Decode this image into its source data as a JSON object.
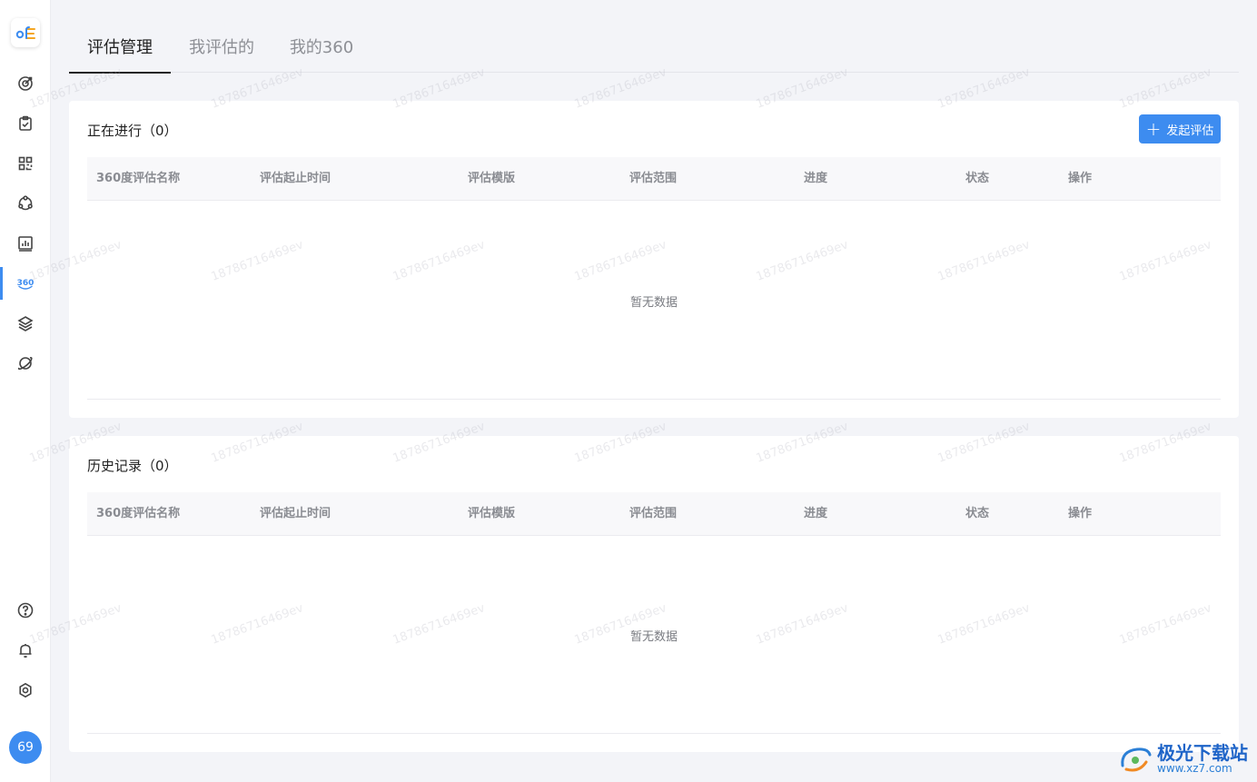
{
  "sidebar": {
    "logo_icon": "of-logo",
    "items": [
      {
        "icon": "target-icon",
        "active": false
      },
      {
        "icon": "clipboard-check-icon",
        "active": false
      },
      {
        "icon": "grid-apps-icon",
        "active": false
      },
      {
        "icon": "org-cycle-icon",
        "active": false
      },
      {
        "icon": "bar-chart-icon",
        "active": false
      },
      {
        "icon": "360-icon",
        "label": "360",
        "active": true
      },
      {
        "icon": "layers-icon",
        "active": false
      },
      {
        "icon": "planet-icon",
        "active": false
      }
    ],
    "bottom_items": [
      {
        "icon": "help-icon"
      },
      {
        "icon": "bell-icon"
      },
      {
        "icon": "settings-icon"
      }
    ],
    "avatar_label": "69",
    "accent": "#3d8cf0"
  },
  "tabs": [
    {
      "label": "评估管理",
      "active": true
    },
    {
      "label": "我评估的",
      "active": false
    },
    {
      "label": "我的360",
      "active": false
    }
  ],
  "ongoing": {
    "title": "正在进行（0）",
    "button_label": "发起评估",
    "columns": [
      "360度评估名称",
      "评估起止时间",
      "评估模版",
      "评估范围",
      "进度",
      "状态",
      "操作"
    ],
    "empty_text": "暂无数据"
  },
  "history": {
    "title": "历史记录（0）",
    "columns": [
      "360度评估名称",
      "评估起止时间",
      "评估模版",
      "评估范围",
      "进度",
      "状态",
      "操作"
    ],
    "empty_text": "暂无数据"
  },
  "watermark": "18786716469ev",
  "brand": {
    "name": "极光下载站",
    "url": "www.xz7.com"
  }
}
